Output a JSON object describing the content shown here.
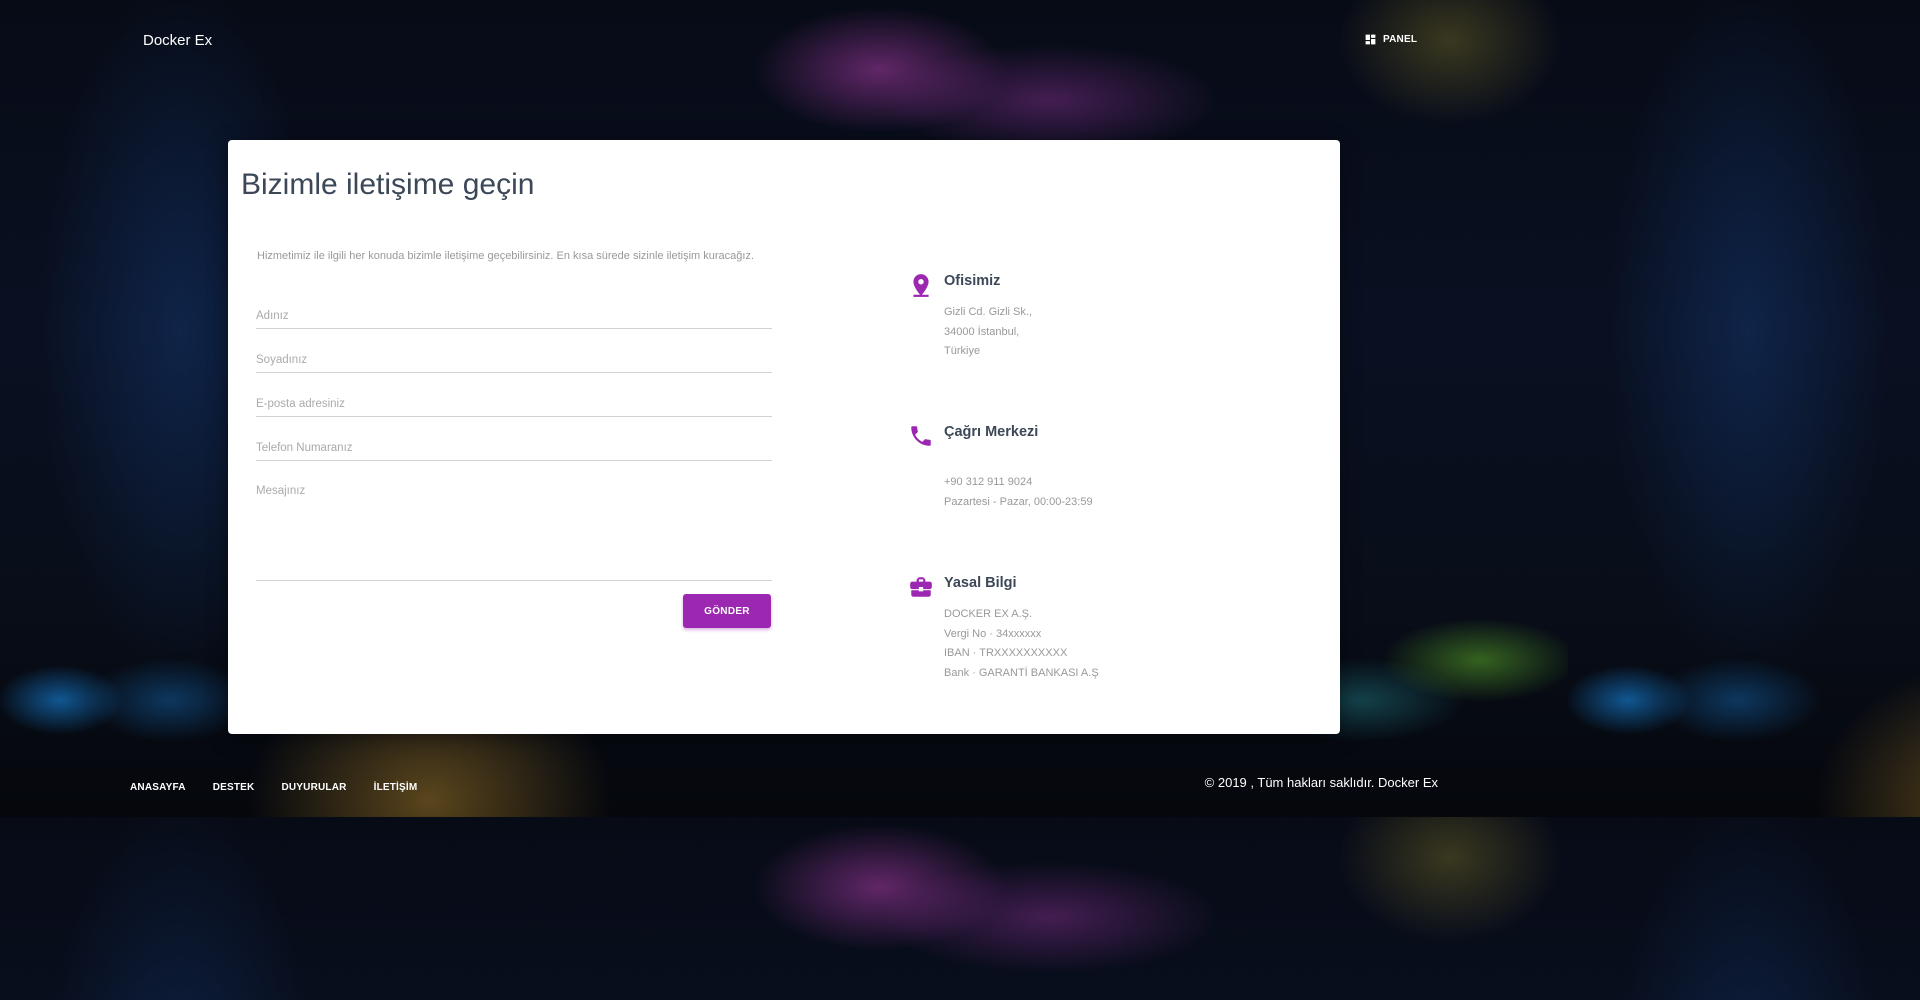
{
  "navbar": {
    "brand": "Docker Ex",
    "panel_label": "PANEL",
    "panel_icon": "dashboard-icon"
  },
  "contact": {
    "title": "Bizimle iletişime geçin",
    "intro": "Hizmetimiz ile ilgili her konuda bizimle iletişime geçebilirsiniz. En kısa sürede sizinle iletişim kuracağız.",
    "form": {
      "name_placeholder": "Adınız",
      "surname_placeholder": "Soyadınız",
      "email_placeholder": "E-posta adresiniz",
      "phone_placeholder": "Telefon Numaranız",
      "message_placeholder": "Mesajınız",
      "submit_label": "GÖNDER"
    },
    "info": {
      "office": {
        "title": "Ofisimiz",
        "icon": "location-pin-icon",
        "lines": [
          "Gizli Cd. Gizli Sk.,",
          "34000 İstanbul,",
          "Türkiye"
        ]
      },
      "call_center": {
        "title": "Çağrı Merkezi",
        "icon": "phone-icon",
        "lines": [
          "+90 312 911 9024",
          "Pazartesi - Pazar, 00:00-23:59"
        ]
      },
      "legal": {
        "title": "Yasal Bilgi",
        "icon": "briefcase-icon",
        "lines": [
          "DOCKER EX A.Ş.",
          "Vergi No · 34xxxxxx",
          "IBAN · TRXXXXXXXXXX",
          "Bank · GARANTİ BANKASI A.Ş"
        ]
      }
    }
  },
  "footer": {
    "links": [
      "ANASAYFA",
      "DESTEK",
      "DUYURULAR",
      "İLETİŞİM"
    ],
    "copyright": "© 2019 , Tüm hakları saklıdır. Docker Ex"
  },
  "colors": {
    "accent": "#9c27b0",
    "card_background": "#ffffff",
    "heading_text": "#3c4858",
    "muted_text": "#999999"
  }
}
